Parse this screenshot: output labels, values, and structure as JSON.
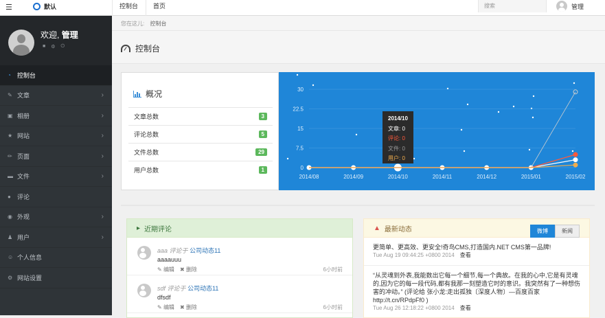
{
  "topbar": {
    "brand": "默认",
    "nav": [
      "控制台",
      "首页"
    ],
    "search_placeholder": "搜索",
    "user_name": "管理"
  },
  "sidebar": {
    "welcome": "欢迎,",
    "user_name": "管理",
    "items": [
      {
        "label": "控制台",
        "icon": "dashboard-icon",
        "active": true
      },
      {
        "label": "文章",
        "icon": "edit-icon",
        "arrow": true
      },
      {
        "label": "相册",
        "icon": "image-icon",
        "arrow": true
      },
      {
        "label": "网站",
        "icon": "star-icon",
        "arrow": true
      },
      {
        "label": "页面",
        "icon": "pencil-icon",
        "arrow": true
      },
      {
        "label": "文件",
        "icon": "folder-icon",
        "arrow": true
      },
      {
        "label": "评论",
        "icon": "comments-icon"
      },
      {
        "label": "外观",
        "icon": "eye-icon",
        "arrow": true
      },
      {
        "label": "用户",
        "icon": "users-icon",
        "arrow": true
      },
      {
        "label": "个人信息",
        "icon": "user-icon"
      },
      {
        "label": "网站设置",
        "icon": "gear-icon"
      }
    ]
  },
  "breadcrumb": {
    "prefix": "您在这儿:",
    "current": "控制台"
  },
  "page_title": "控制台",
  "overview": {
    "title": "概况",
    "stats": [
      {
        "label": "文章总数",
        "value": "3"
      },
      {
        "label": "评论总数",
        "value": "5"
      },
      {
        "label": "文件总数",
        "value": "29"
      },
      {
        "label": "用户总数",
        "value": "1"
      }
    ]
  },
  "chart_data": {
    "type": "line",
    "x": [
      "2014/08",
      "2014/09",
      "2014/10",
      "2014/11",
      "2014/12",
      "2015/01",
      "2015/02"
    ],
    "y_ticks": [
      "0",
      "7.5",
      "15",
      "22.5",
      "30"
    ],
    "ylim": [
      0,
      30
    ],
    "series": [
      {
        "name": "文章",
        "color": "#ffffff",
        "values": [
          0,
          0,
          0,
          0,
          0,
          0,
          3
        ]
      },
      {
        "name": "评论",
        "color": "#ff5a3c",
        "values": [
          0,
          0,
          0,
          0,
          0,
          0,
          5
        ]
      },
      {
        "name": "文件",
        "color": "#cfcfcf",
        "values": [
          0,
          0,
          0,
          0,
          0,
          0,
          29
        ]
      },
      {
        "name": "用户",
        "color": "#f0ad4e",
        "values": [
          0,
          0,
          0,
          0,
          0,
          0,
          1
        ]
      }
    ],
    "tooltip": {
      "title": "2014/10",
      "rows": [
        {
          "label": "文章: 0",
          "color": "#ffffff"
        },
        {
          "label": "评论: 0",
          "color": "#ff5a3c"
        },
        {
          "label": "文件: 0",
          "color": "#9a9a9a"
        },
        {
          "label": "用户: 0",
          "color": "#f0ad4e"
        }
      ]
    }
  },
  "comments": {
    "title": "近期评论",
    "items": [
      {
        "author": "aaa",
        "verb": "评论于",
        "target": "公司动态11",
        "body": "aaaauuu",
        "edit": "编辑",
        "delete": "删除",
        "time": "6小时前"
      },
      {
        "author": "sdf",
        "verb": "评论于",
        "target": "公司动态11",
        "body": "dfsdf",
        "edit": "编辑",
        "delete": "删除",
        "time": "6小时前"
      }
    ]
  },
  "news": {
    "title": "最新动态",
    "tabs": [
      "微博",
      "新闻"
    ],
    "items": [
      {
        "text": "更简单、更高效、更安全!奇鸟CMS,打造国内.NET CMS第一品牌!",
        "time": "Tue Aug 19 09:44:25 +0800 2014",
        "link": "查看"
      },
      {
        "text": "“从灵魂到外表,我能数出它每一个细节,每一个典故。在我的心中,它是有灵魂的,因为它的每一段代码,都有我那一刻塑造它时的意识。我突然有了一种想伤害的冲动。” (评论给 张小龙:走出孤独〔深度人物〕—百度百家 http://t.cn/RPdpFf0 )",
        "time": "Tue Aug 26 12:18:22 +0800 2014",
        "link": "查看"
      }
    ]
  }
}
